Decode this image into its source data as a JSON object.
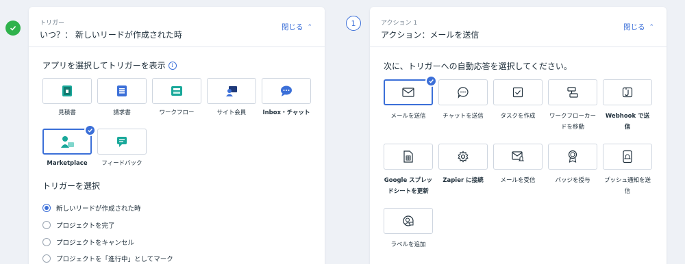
{
  "colors": {
    "accent": "#3b6fd8",
    "success": "#2fb24c",
    "teal": "#19a89a"
  },
  "left": {
    "kicker": "トリガー",
    "title": "いつ？： 新しいリードが作成された時",
    "close_label": "閉じる",
    "apps_label": "アプリを選択してトリガーを表示",
    "apps": [
      {
        "label": "見積書",
        "icon": "quote-doc-icon",
        "bold": false,
        "selected": false
      },
      {
        "label": "請求書",
        "icon": "invoice-icon",
        "bold": false,
        "selected": false
      },
      {
        "label": "ワークフロー",
        "icon": "workflow-icon",
        "bold": false,
        "selected": false
      },
      {
        "label": "サイト会員",
        "icon": "site-members-icon",
        "bold": false,
        "selected": false
      },
      {
        "label": "Inbox・チャット",
        "icon": "inbox-chat-icon",
        "bold": true,
        "selected": false
      },
      {
        "label": "Marketplace",
        "icon": "marketplace-icon",
        "bold": true,
        "selected": true
      },
      {
        "label": "フィードバック",
        "icon": "feedback-icon",
        "bold": false,
        "selected": false
      }
    ],
    "trigger_label": "トリガーを選択",
    "triggers": [
      {
        "label": "新しいリードが作成された時",
        "selected": true
      },
      {
        "label": "プロジェクトを完了",
        "selected": false
      },
      {
        "label": "プロジェクトをキャンセル",
        "selected": false
      },
      {
        "label": "プロジェクトを「進行中」としてマーク",
        "selected": false
      }
    ]
  },
  "right": {
    "step_number": "1",
    "kicker": "アクション 1",
    "title": "アクション：メールを送信",
    "close_label": "閉じる",
    "prompt": "次に、トリガーへの自動応答を選択してください。",
    "actions": [
      {
        "label": "メールを送信",
        "icon": "mail-icon",
        "selected": true
      },
      {
        "label": "チャットを送信",
        "icon": "chat-icon",
        "selected": false
      },
      {
        "label": "タスクを作成",
        "icon": "task-check-icon",
        "selected": false
      },
      {
        "label": "ワークフローカードを移動",
        "icon": "move-card-icon",
        "selected": false
      },
      {
        "label": "Webhook で送信",
        "icon": "webhook-icon",
        "selected": false
      },
      {
        "label": "Google スプレッドシートを更新",
        "icon": "spreadsheet-icon",
        "selected": false
      },
      {
        "label": "Zapier に接続",
        "icon": "gear-icon",
        "selected": false
      },
      {
        "label": "メールを受信",
        "icon": "mail-bell-icon",
        "selected": false
      },
      {
        "label": "バッジを授与",
        "icon": "badge-icon",
        "selected": false
      },
      {
        "label": "プッシュ通知を送信",
        "icon": "push-notification-icon",
        "selected": false
      },
      {
        "label": "ラベルを追加",
        "icon": "add-label-icon",
        "selected": false
      }
    ]
  }
}
